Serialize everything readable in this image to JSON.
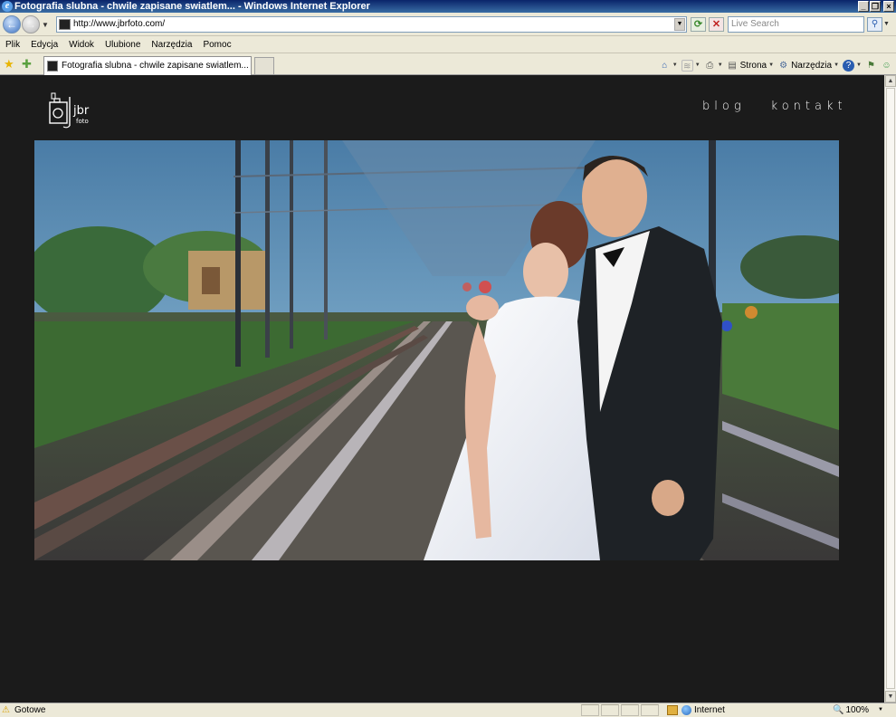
{
  "window": {
    "title": "Fotografia slubna - chwile zapisane swiatlem... - Windows Internet Explorer"
  },
  "address": {
    "url": "http://www.jbrfoto.com/",
    "search_placeholder": "Live Search"
  },
  "menu": [
    "Plik",
    "Edycja",
    "Widok",
    "Ulubione",
    "Narzędzia",
    "Pomoc"
  ],
  "tab": {
    "title": "Fotografia slubna - chwile zapisane swiatlem..."
  },
  "commands": {
    "page": "Strona",
    "tools": "Narzędzia"
  },
  "site": {
    "logo_main": "jbr",
    "logo_sub": "foto",
    "nav": [
      "blog",
      "kontakt"
    ]
  },
  "status": {
    "text": "Gotowe",
    "zone": "Internet",
    "zoom": "100%"
  }
}
